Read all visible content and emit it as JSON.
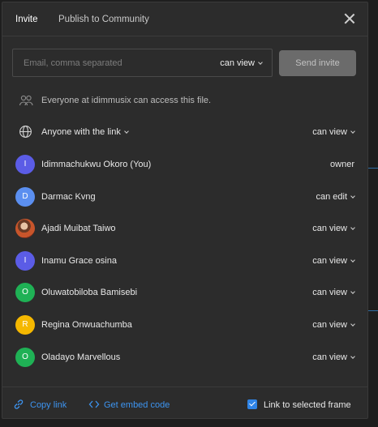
{
  "tabs": [
    {
      "label": "Invite",
      "active": true
    },
    {
      "label": "Publish to Community",
      "active": false
    }
  ],
  "invite": {
    "email_placeholder": "Email, comma separated",
    "email_value": "",
    "permission": "can view",
    "send_label": "Send invite"
  },
  "org_access": {
    "icon": "people-icon",
    "text": "Everyone at idimmusix can access this file."
  },
  "link_access": {
    "icon": "globe-icon",
    "label": "Anyone with the link",
    "permission": "can view"
  },
  "members": [
    {
      "name": "Idimmachukwu Okoro (You)",
      "initial": "I",
      "color": "#5b5ce6",
      "permission": "owner",
      "has_dropdown": false,
      "photo": false
    },
    {
      "name": "Darmac Kvng",
      "initial": "D",
      "color": "#5b8ff0",
      "permission": "can edit",
      "has_dropdown": true,
      "photo": false
    },
    {
      "name": "Ajadi Muibat Taiwo",
      "initial": "",
      "color": "#b5462a",
      "permission": "can view",
      "has_dropdown": true,
      "photo": true
    },
    {
      "name": "Inamu Grace osina",
      "initial": "I",
      "color": "#5b5ce6",
      "permission": "can view",
      "has_dropdown": true,
      "photo": false
    },
    {
      "name": "Oluwatobiloba Bamisebi",
      "initial": "O",
      "color": "#1fb155",
      "permission": "can view",
      "has_dropdown": true,
      "photo": false
    },
    {
      "name": "Regina Onwuachumba",
      "initial": "R",
      "color": "#f5b800",
      "permission": "can view",
      "has_dropdown": true,
      "photo": false
    },
    {
      "name": "Oladayo Marvellous",
      "initial": "O",
      "color": "#1fb155",
      "permission": "can view",
      "has_dropdown": true,
      "photo": false
    }
  ],
  "footer": {
    "copy_link": "Copy link",
    "embed_code": "Get embed code",
    "link_selected_frame": "Link to selected frame",
    "link_selected_frame_checked": true
  },
  "colors": {
    "accent": "#3d94f0",
    "background": "#2c2c2c"
  }
}
